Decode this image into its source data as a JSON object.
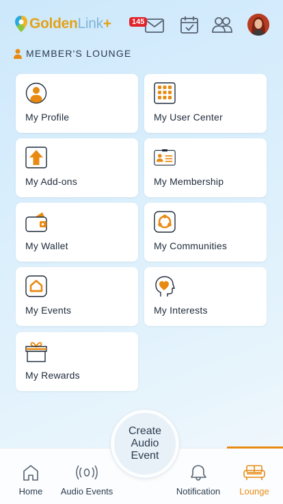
{
  "header": {
    "logo": {
      "part1": "Golden",
      "part2": "Link",
      "part3": "+"
    },
    "mail_badge": "145"
  },
  "section": {
    "title": "MEMBER'S LOUNGE"
  },
  "cards": [
    {
      "label": "My Profile",
      "icon": "profile-icon"
    },
    {
      "label": "My User Center",
      "icon": "grid-icon"
    },
    {
      "label": "My Add-ons",
      "icon": "upload-arrow-icon"
    },
    {
      "label": "My Membership",
      "icon": "id-card-icon"
    },
    {
      "label": "My Wallet",
      "icon": "wallet-icon"
    },
    {
      "label": "My Communities",
      "icon": "communities-icon"
    },
    {
      "label": "My Events",
      "icon": "events-icon"
    },
    {
      "label": "My Interests",
      "icon": "heart-head-icon"
    },
    {
      "label": "My Rewards",
      "icon": "gift-icon"
    }
  ],
  "fab": {
    "label": "Create Audio Event"
  },
  "nav": {
    "items": [
      {
        "label": "Home",
        "icon": "home-icon"
      },
      {
        "label": "Audio Events",
        "icon": "broadcast-icon"
      },
      {
        "label": "Notification",
        "icon": "bell-chat-icon"
      },
      {
        "label": "Lounge",
        "icon": "sofa-icon",
        "active": true
      }
    ]
  },
  "colors": {
    "accent": "#e88a12",
    "badge": "#e0242c",
    "text": "#1d2a3a"
  }
}
